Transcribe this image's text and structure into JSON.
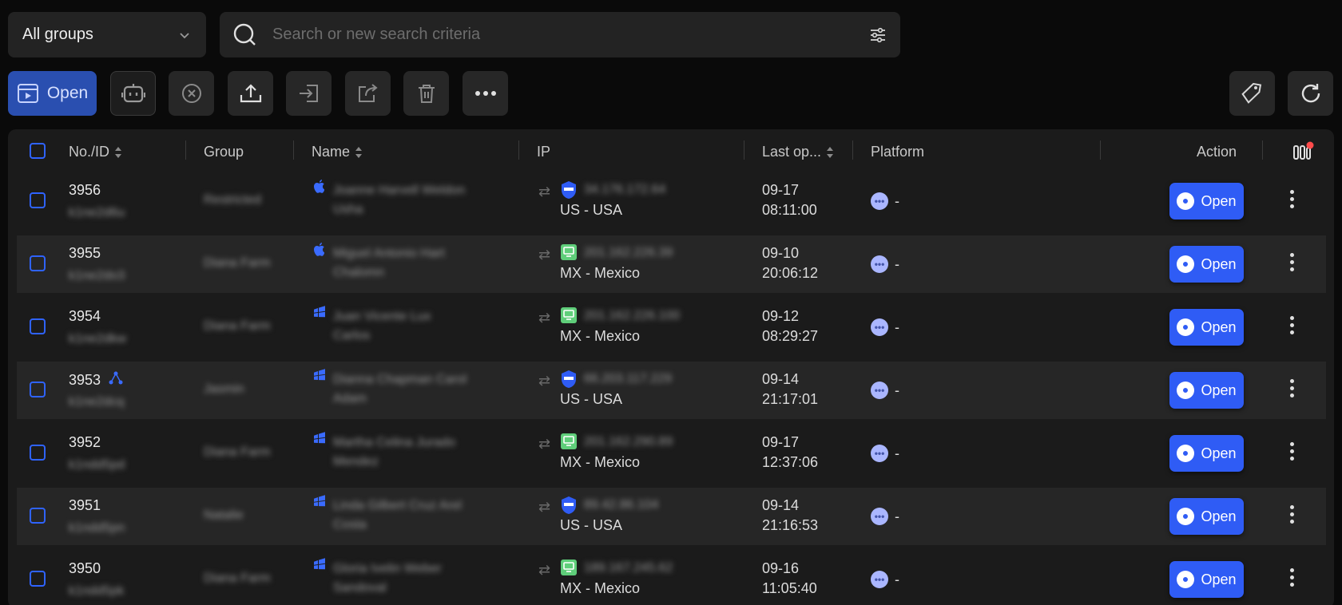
{
  "filter": {
    "group": "All groups",
    "search_placeholder": "Search or new search criteria"
  },
  "toolbar": {
    "open_label": "Open"
  },
  "columns": {
    "no_id": "No./ID",
    "group": "Group",
    "name": "Name",
    "ip": "IP",
    "last_open": "Last op...",
    "platform": "Platform",
    "action": "Action"
  },
  "rows": [
    {
      "no": "3956",
      "id": "k1ne2d6u",
      "group": "Restricted",
      "name1": "Joanne Harvell Weldon",
      "name2": "Usha",
      "ip": "34.176.172.64",
      "ip_type": "shield",
      "location": "US - USA",
      "date": "09-17",
      "time": "08:11:00",
      "os": "apple",
      "platform": "-",
      "action": "Open"
    },
    {
      "no": "3955",
      "id": "k1ne2do3",
      "group": "Diana Farm",
      "name1": "Miguel Antonio Hart",
      "name2": "Chalomn",
      "ip": "201.162.226.39",
      "ip_type": "green",
      "location": "MX - Mexico",
      "date": "09-10",
      "time": "20:06:12",
      "os": "apple",
      "platform": "-",
      "action": "Open"
    },
    {
      "no": "3954",
      "id": "k1ne2dkw",
      "group": "Diana Farm",
      "name1": "Juan Vicente Lux",
      "name2": "Carlos",
      "ip": "201.162.226.100",
      "ip_type": "green",
      "location": "MX - Mexico",
      "date": "09-12",
      "time": "08:29:27",
      "os": "windows",
      "platform": "-",
      "action": "Open"
    },
    {
      "no": "3953",
      "id": "k1ne2dcq",
      "group": "Jasmin",
      "name1": "Dianna Chapman Carol",
      "name2": "Adam",
      "ip": "66.203.117.229",
      "ip_type": "shield",
      "location": "US - USA",
      "date": "09-14",
      "time": "21:17:01",
      "os": "windows",
      "platform": "-",
      "action": "Open"
    },
    {
      "no": "3952",
      "id": "k1ndd5pd",
      "group": "Diana Farm",
      "name1": "Martha Celina Jurado",
      "name2": "Mendez",
      "ip": "201.162.290.89",
      "ip_type": "green",
      "location": "MX - Mexico",
      "date": "09-17",
      "time": "12:37:06",
      "os": "windows",
      "platform": "-",
      "action": "Open"
    },
    {
      "no": "3951",
      "id": "k1ndd5pn",
      "group": "Natalie",
      "name1": "Linda Gilbert Cruz Arel",
      "name2": "Costa",
      "ip": "89.42.86.104",
      "ip_type": "shield",
      "location": "US - USA",
      "date": "09-14",
      "time": "21:16:53",
      "os": "windows",
      "platform": "-",
      "action": "Open"
    },
    {
      "no": "3950",
      "id": "k1ndd5pk",
      "group": "Diana Farm",
      "name1": "Gloria Ivelin Weber",
      "name2": "Sandoval",
      "ip": "189.167.245.62",
      "ip_type": "green",
      "location": "MX - Mexico",
      "date": "09-16",
      "time": "11:05:40",
      "os": "windows",
      "platform": "-",
      "action": "Open"
    }
  ],
  "colors": {
    "accent": "#2f5cf5",
    "bg": "#0a0a0a",
    "table": "#1b1b1b"
  }
}
